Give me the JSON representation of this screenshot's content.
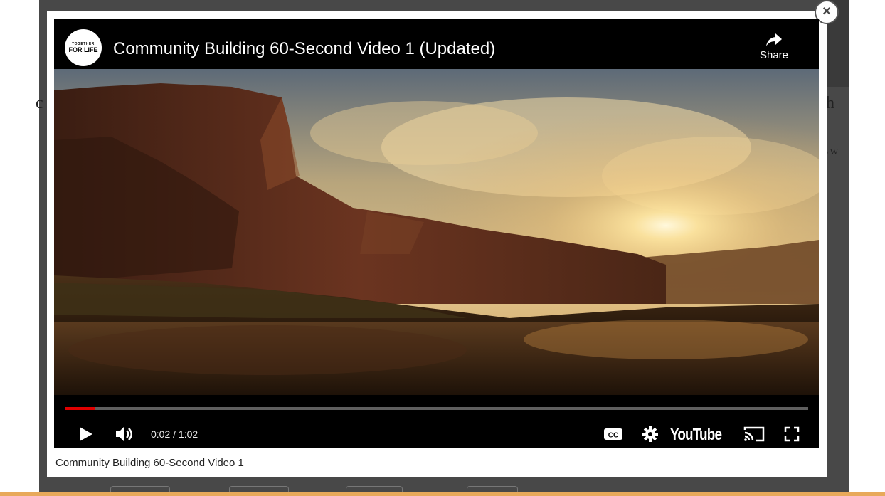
{
  "video": {
    "title": "Community Building 60-Second Video 1 (Updated)",
    "channel_logo_line1": "TOGETHER",
    "channel_logo_line2": "FOR LIFE",
    "share_label": "Share",
    "progress": 0.04,
    "time_current": "0:02",
    "time_total": "1:02",
    "time_display": "0:02 / 1:02",
    "youtube_label": "YouTube",
    "cc_label": "CC"
  },
  "lightbox": {
    "caption": "Community Building 60-Second Video 1",
    "close_label": "×"
  },
  "background": {
    "frag_left": "c",
    "frag_right": "h",
    "frag_right_small": "o W"
  },
  "colors": {
    "progress": "#e00000",
    "player_bg": "#000000",
    "overlay": "#484848",
    "accent_bottom": "#e8a95a"
  },
  "icons": {
    "play": "play-icon",
    "volume": "volume-icon",
    "cc": "closed-captions-icon",
    "settings": "gear-icon",
    "cast": "cast-icon",
    "fullscreen": "fullscreen-icon",
    "share": "share-arrow-icon",
    "close": "close-icon"
  }
}
